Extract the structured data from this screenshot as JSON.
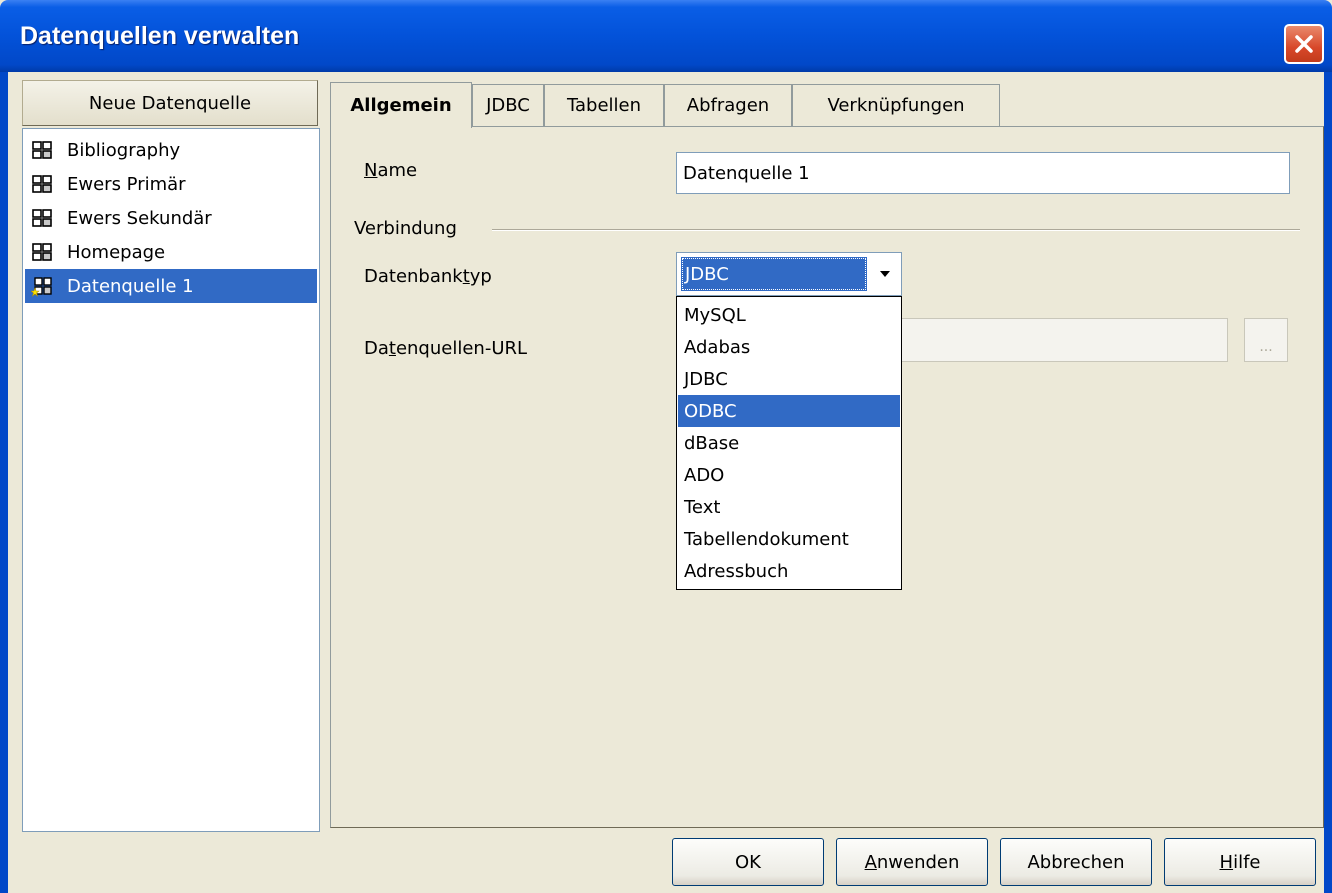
{
  "window": {
    "title": "Datenquellen verwalten"
  },
  "left_pane": {
    "new_datasource_label": "Neue Datenquelle",
    "datasources": [
      {
        "label": "Bibliography",
        "selected": false
      },
      {
        "label": "Ewers Primär",
        "selected": false
      },
      {
        "label": "Ewers Sekundär",
        "selected": false
      },
      {
        "label": "Homepage",
        "selected": false
      },
      {
        "label": "Datenquelle 1",
        "selected": true
      }
    ]
  },
  "tabs": [
    {
      "label": "Allgemein",
      "active": true
    },
    {
      "label": "JDBC",
      "active": false
    },
    {
      "label": "Tabellen",
      "active": false
    },
    {
      "label": "Abfragen",
      "active": false
    },
    {
      "label": "Verknüpfungen",
      "active": false
    }
  ],
  "general": {
    "name_label_mnemonic": "N",
    "name_label_rest": "ame",
    "name_value": "Datenquelle 1",
    "connection_group_label": "Verbindung",
    "dbtype_label_pre": "Datenbank",
    "dbtype_label_mnemonic": "t",
    "dbtype_label_post": "yp",
    "dbtype_value": "JDBC",
    "url_label_pre": "Da",
    "url_label_mnemonic": "t",
    "url_label_post": "enquellen-URL",
    "url_value": "",
    "browse_label": "..."
  },
  "dbtype_dropdown": {
    "options": [
      "MySQL",
      "Adabas",
      "JDBC",
      "ODBC",
      "dBase",
      "ADO",
      "Text",
      "Tabellendokument",
      "Adressbuch"
    ],
    "highlighted": "ODBC"
  },
  "buttons": {
    "ok": "OK",
    "apply_mnemonic": "A",
    "apply_rest": "nwenden",
    "cancel": "Abbrechen",
    "help_mnemonic": "H",
    "help_rest": "ilfe"
  },
  "colors": {
    "titlebar": "#0352d9",
    "selection": "#316ac5",
    "dialog_bg": "#ece9d8"
  }
}
